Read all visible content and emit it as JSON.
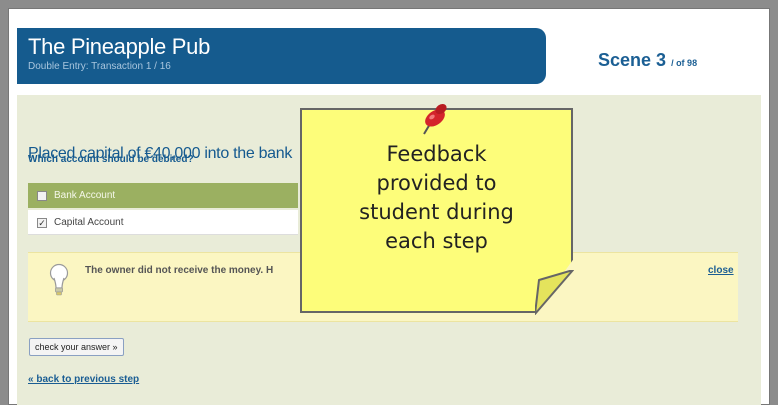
{
  "header": {
    "title": "The Pineapple Pub",
    "subtitle": "Double Entry: Transaction 1 / 16",
    "scene_label": "Scene 3",
    "scene_total": "/ of 98"
  },
  "question": {
    "title": "Placed capital of €40,000 into the bank",
    "prompt": "Which account should be debited?"
  },
  "options": [
    {
      "label": "Bank Account",
      "checked": false
    },
    {
      "label": "Capital Account",
      "checked": true
    }
  ],
  "feedback": {
    "text": "The owner did not receive the money. H",
    "close_label": "close"
  },
  "actions": {
    "check_label": "check your answer »",
    "back_label": "« back to previous step"
  },
  "sticky_note": {
    "line1": "Feedback",
    "line2": "provided to",
    "line3": "student during",
    "line4": "each step"
  },
  "colors": {
    "header_blue": "#155b8e",
    "panel_bg": "#e9ecd8",
    "selected_option": "#9bb061",
    "feedback_bg": "#fbf6c2",
    "note_yellow": "#fdfd7a",
    "pin_red": "#d4242b"
  },
  "icons": [
    "lightbulb-icon",
    "pushpin-icon",
    "checkbox-icon"
  ]
}
